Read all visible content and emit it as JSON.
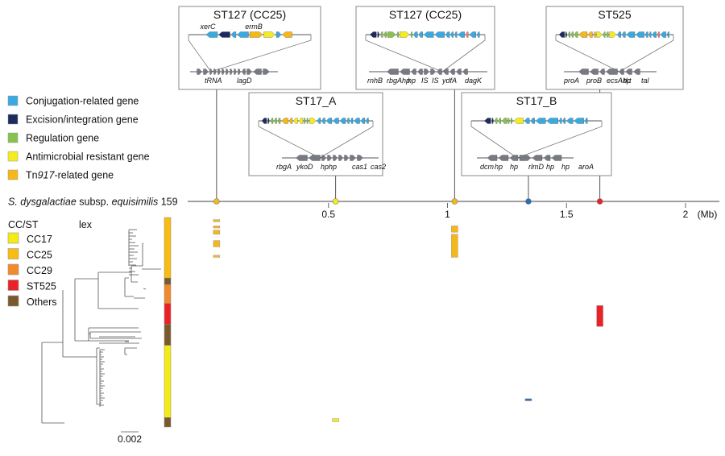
{
  "colors": {
    "conjugation": "#3aa9e0",
    "excision": "#1c2a5e",
    "regulation": "#86c250",
    "antimicrobial": "#f4ec22",
    "tn917": "#f6b818",
    "other_gene": "#777a80",
    "insert_pink": "#ee7a80",
    "cc17": "#f4ea16",
    "cc25": "#f8bc12",
    "cc29": "#f08a2a",
    "st525": "#ea2228",
    "others": "#7a5a2a",
    "blue_marker": "#2a6cb8"
  },
  "gene_legend": [
    {
      "label": "Conjugation-related gene",
      "color_key": "conjugation"
    },
    {
      "label": "Excision/integration gene",
      "color_key": "excision"
    },
    {
      "label": "Regulation gene",
      "color_key": "regulation"
    },
    {
      "label": "Antimicrobial resistant gene",
      "color_key": "antimicrobial"
    },
    {
      "label_prefix": "Tn",
      "label_italic": "917",
      "label_suffix": "-related gene",
      "color_key": "tn917"
    }
  ],
  "reference": {
    "genus_species_italic": "S. dysgalactiae",
    "subsp_text": " subsp. ",
    "subsp_italic": "equisimilis",
    "strain": " 159"
  },
  "axis": {
    "unit": "(Mb)",
    "ticks": [
      "0.5",
      "1",
      "1.5",
      "2"
    ],
    "tick_values": [
      0.5,
      1,
      1.5,
      2
    ],
    "max": 2.1
  },
  "insertions": [
    {
      "title": "ST127 (CC25)",
      "position_mb": 0.03,
      "marker_color_key": "tn917",
      "top_labels": [
        "xerC",
        "ermB"
      ],
      "bottom_labels": [
        "tRNA",
        "lagD"
      ]
    },
    {
      "title": "ST17_A",
      "position_mb": 0.53,
      "marker_color_key": "antimicrobial",
      "top_labels": [],
      "bottom_labels": [
        "rbgA",
        "ykoD",
        "hphp",
        "cas1",
        "cas2"
      ]
    },
    {
      "title": "ST127 (CC25)",
      "position_mb": 1.03,
      "marker_color_key": "tn917",
      "top_labels": [],
      "bottom_labels": [
        "rnhB",
        "rbgAhp",
        "hp",
        "IS",
        "IS",
        "ydfA",
        "dagK"
      ]
    },
    {
      "title": "ST17_B",
      "position_mb": 1.34,
      "marker_color_key": "blue_marker",
      "top_labels": [],
      "bottom_labels": [
        "dcm",
        "hp",
        "hp",
        "rlmD",
        "hp",
        "hp",
        "aroA"
      ]
    },
    {
      "title": "ST525",
      "position_mb": 1.64,
      "marker_color_key": "st525",
      "top_labels": [],
      "bottom_labels": [
        "proA",
        "proB",
        "ecsAhp",
        "tkt",
        "tal"
      ]
    }
  ],
  "ccst_legend": {
    "title": "CC/ST",
    "tree_label": "lex",
    "items": [
      {
        "label": "CC17",
        "color_key": "cc17"
      },
      {
        "label": "CC25",
        "color_key": "cc25"
      },
      {
        "label": "CC29",
        "color_key": "cc29"
      },
      {
        "label": "ST525",
        "color_key": "st525"
      },
      {
        "label": "Others",
        "color_key": "others"
      }
    ]
  },
  "strip_segments": [
    {
      "group": "CC25",
      "color_key": "cc25",
      "span": [
        0,
        0.289
      ]
    },
    {
      "group": "Others",
      "color_key": "others",
      "span": [
        0.289,
        0.32
      ]
    },
    {
      "group": "CC29",
      "color_key": "cc29",
      "span": [
        0.32,
        0.41
      ]
    },
    {
      "group": "ST525",
      "color_key": "st525",
      "span": [
        0.41,
        0.51
      ]
    },
    {
      "group": "Others",
      "color_key": "others",
      "span": [
        0.51,
        0.61
      ]
    },
    {
      "group": "CC17",
      "color_key": "cc17",
      "span": [
        0.61,
        0.955
      ]
    },
    {
      "group": "Others",
      "color_key": "others",
      "span": [
        0.955,
        1.0
      ]
    }
  ],
  "presence_marks": [
    {
      "position_mb": 0.03,
      "color_key": "tn917",
      "rows": [
        [
          0.01,
          0.02
        ],
        [
          0.04,
          0.05
        ],
        [
          0.06,
          0.08
        ],
        [
          0.11,
          0.14
        ],
        [
          0.18,
          0.19
        ]
      ]
    },
    {
      "position_mb": 1.03,
      "color_key": "tn917",
      "rows": [
        [
          0.04,
          0.07
        ],
        [
          0.08,
          0.19
        ]
      ]
    },
    {
      "position_mb": 1.64,
      "color_key": "st525",
      "rows": [
        [
          0.42,
          0.52
        ]
      ]
    },
    {
      "position_mb": 1.34,
      "color_key": "blue_marker",
      "rows": [
        [
          0.865,
          0.875
        ]
      ]
    },
    {
      "position_mb": 0.53,
      "color_key": "antimicrobial",
      "rows": [
        [
          0.96,
          0.975
        ]
      ]
    }
  ],
  "scale_bar": {
    "label": "0.002"
  }
}
